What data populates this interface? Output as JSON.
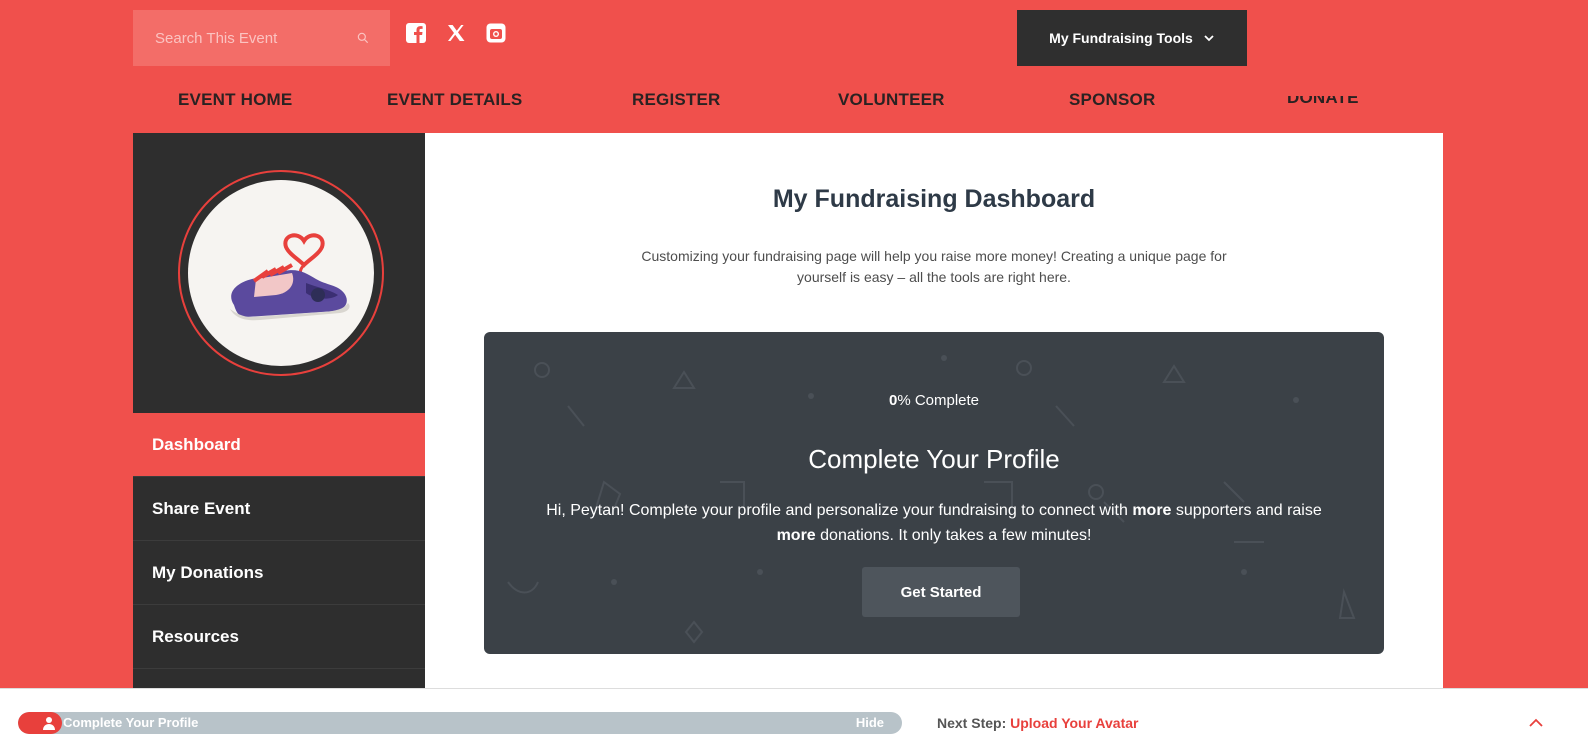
{
  "search": {
    "placeholder": "Search This Event"
  },
  "social": [
    "facebook-icon",
    "x-icon",
    "instagram-icon"
  ],
  "tools_button": {
    "label": "My Fundraising Tools"
  },
  "nav": [
    {
      "label": "EVENT HOME"
    },
    {
      "label": "EVENT DETAILS"
    },
    {
      "label": "REGISTER"
    },
    {
      "label": "VOLUNTEER"
    },
    {
      "label": "SPONSOR"
    },
    {
      "label": "DONATE"
    }
  ],
  "sidebar": {
    "items": [
      {
        "label": "Dashboard",
        "active": true
      },
      {
        "label": "Share Event"
      },
      {
        "label": "My Donations"
      },
      {
        "label": "Resources"
      }
    ]
  },
  "main": {
    "title": "My Fundraising Dashboard",
    "subtitle": "Customizing your fundraising page will help you raise more money! Creating a unique page for yourself is easy – all the tools are right here.",
    "card": {
      "percent_value": "0",
      "percent_suffix": "% Complete",
      "title": "Complete Your Profile",
      "text_part1": "Hi, Peytan! Complete your profile and personalize your fundraising to connect with ",
      "text_bold1": "more",
      "text_part2": " supporters and raise ",
      "text_bold2": "more",
      "text_part3": " donations. It only takes a few minutes!",
      "button": "Get Started"
    }
  },
  "bottom_bar": {
    "progress_label": "Complete Your Profile",
    "progress_fraction": 0,
    "hide_label": "Hide",
    "next_step_label": "Next Step:",
    "next_step_value": "Upload Your Avatar"
  },
  "colors": {
    "brand": "#f0504c",
    "accent_red": "#e8403c",
    "sidebar_bg": "#2e2e2e",
    "card_bg": "#3b4147"
  }
}
